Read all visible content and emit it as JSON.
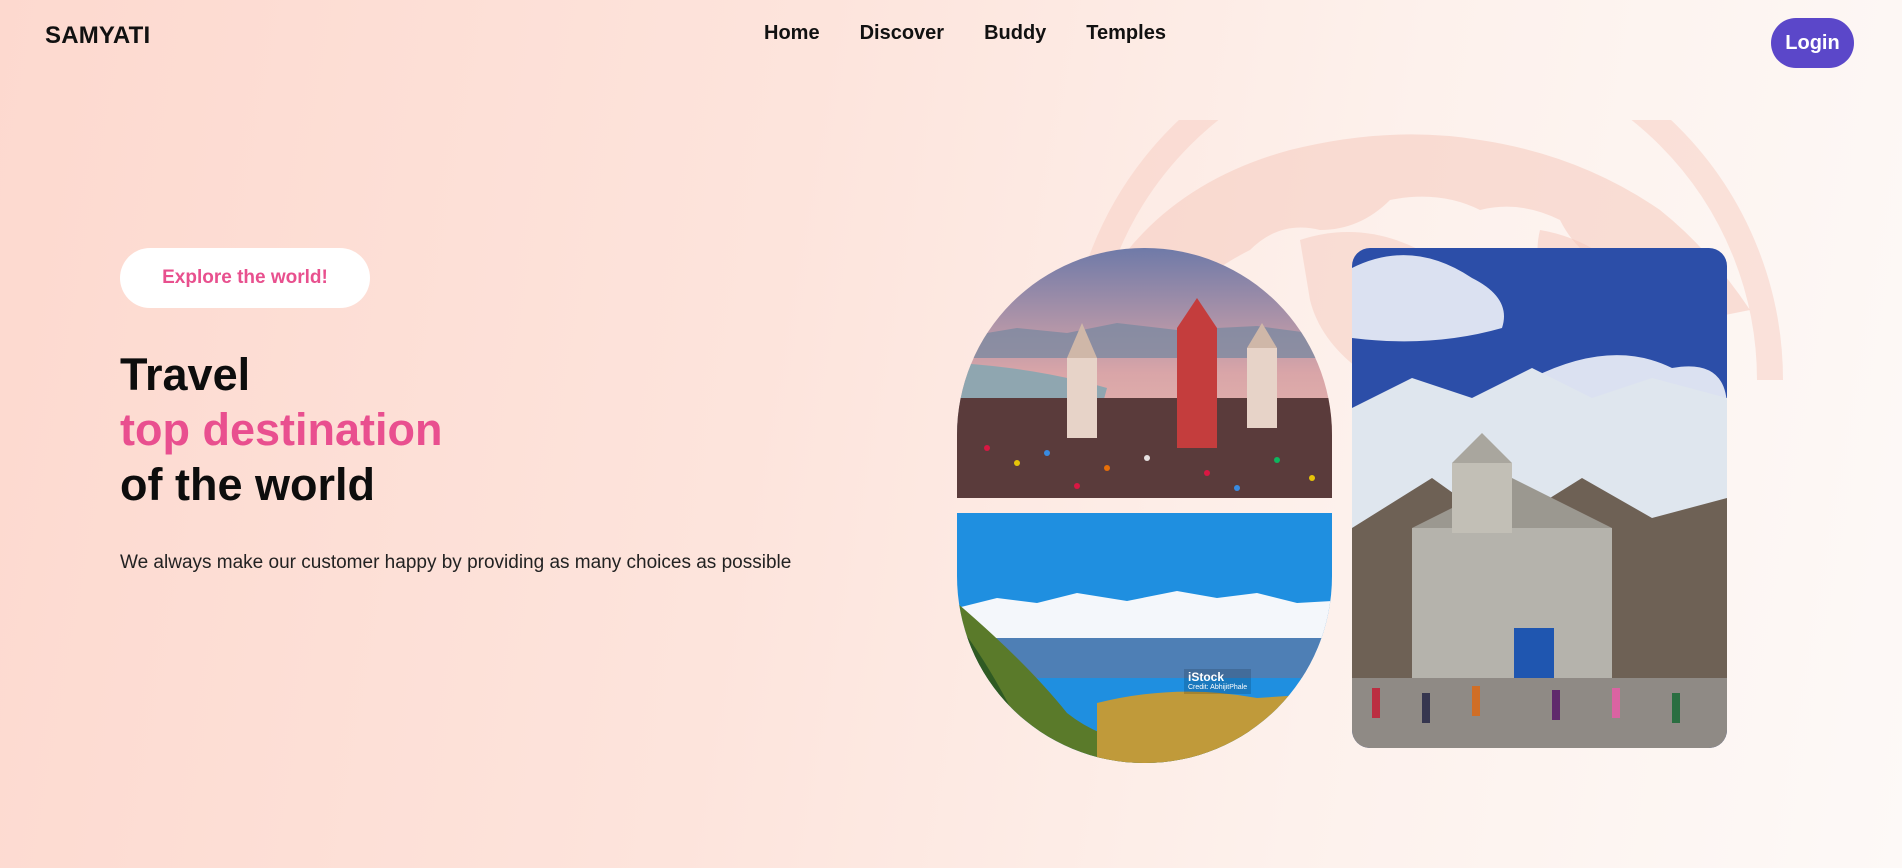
{
  "brand": "SAMYATI",
  "nav": {
    "items": [
      "Home",
      "Discover",
      "Buddy",
      "Temples"
    ],
    "login": "Login"
  },
  "hero": {
    "badge": "Explore the world!",
    "line1": "Travel",
    "line2": "top destination",
    "line3": "of the world",
    "subtitle": "We always make our customer happy by providing as many choices as possible"
  },
  "images": {
    "hills_watermark": "iStock",
    "hills_credit": "Credit: AbhijitPhale"
  },
  "colors": {
    "accent": "#e94f8f",
    "button": "#5b47c9"
  }
}
